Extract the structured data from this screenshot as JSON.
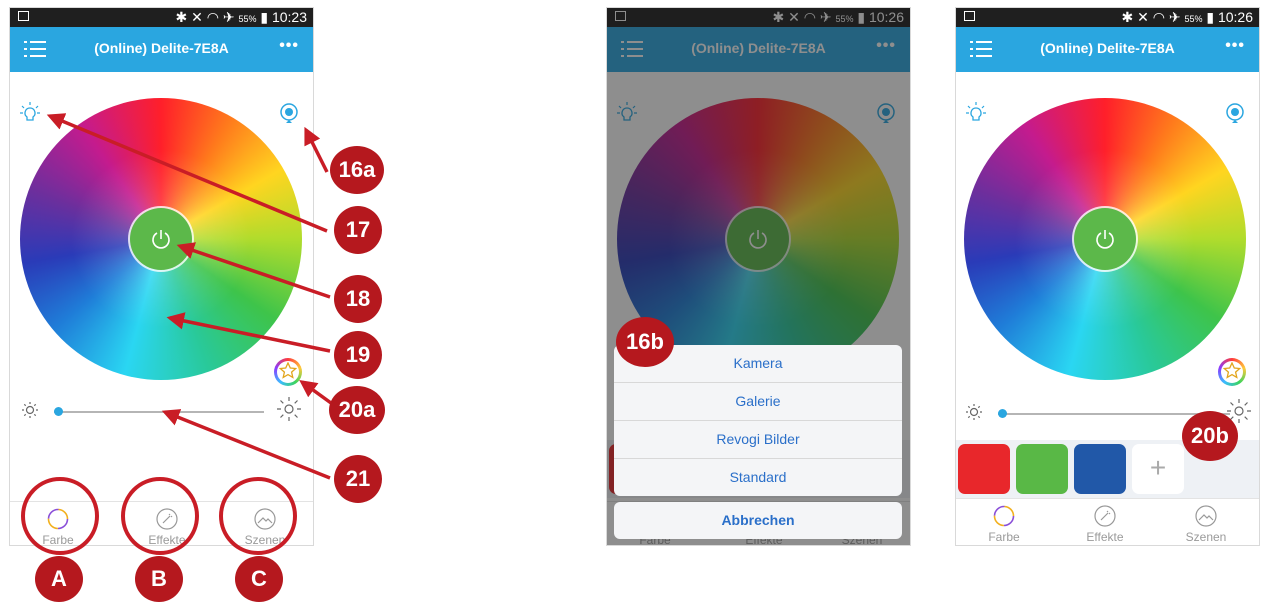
{
  "status": {
    "battery": "55%",
    "times": [
      "10:23",
      "10:26",
      "10:26"
    ]
  },
  "app": {
    "title": "(Online) Delite-7E8A",
    "more": "•••"
  },
  "tabs": [
    {
      "label": "Farbe",
      "icon": "color-wheel-icon"
    },
    {
      "label": "Effekte",
      "icon": "magic-wand-icon"
    },
    {
      "label": "Szenen",
      "icon": "scene-picture-icon"
    }
  ],
  "slider": {
    "brightness": 0.02
  },
  "sheet": {
    "items": [
      "Kamera",
      "Galerie",
      "Revogi Bilder",
      "Standard"
    ],
    "cancel": "Abbrechen"
  },
  "swatches": [
    "#e8272b",
    "#59b846",
    "#2158a8"
  ],
  "plus": "+",
  "callouts": {
    "c16a": "16a",
    "c17": "17",
    "c18": "18",
    "c19": "19",
    "c20a": "20a",
    "c21": "21",
    "cA": "A",
    "cB": "B",
    "cC": "C",
    "c16b": "16b",
    "c20b": "20b"
  },
  "colors": {
    "accent": "#2aa6e0",
    "power": "#5cb84a",
    "callout": "#b5181e"
  }
}
